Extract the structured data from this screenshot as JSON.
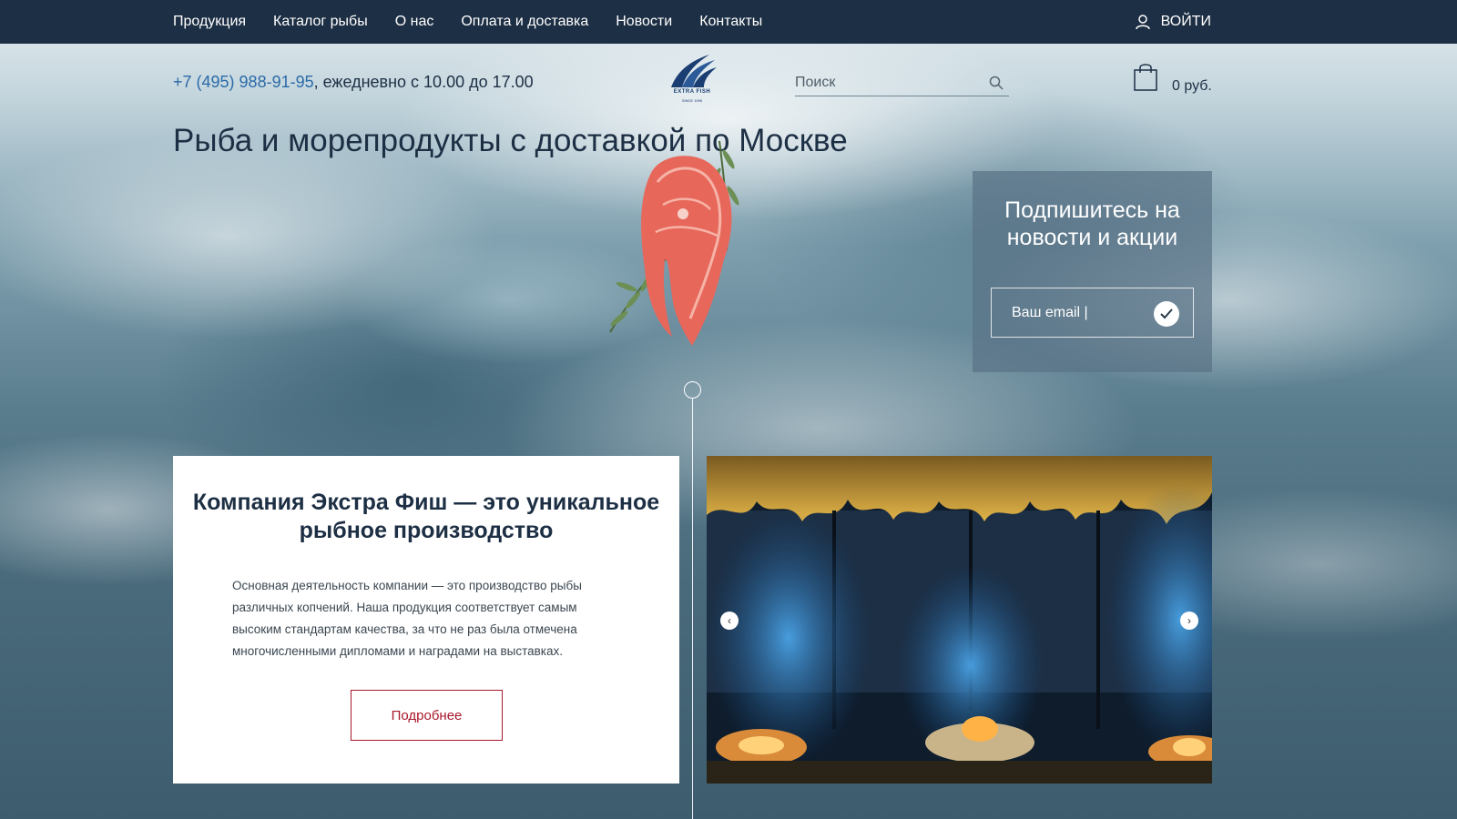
{
  "nav": {
    "items": [
      "Продукция",
      "Каталог рыбы",
      "О нас",
      "Оплата и доставка",
      "Новости",
      "Контакты"
    ],
    "login": "ВОЙТИ"
  },
  "header": {
    "phone": "+7 (495) 988-91-95",
    "hours": ", ежедневно с 10.00 до 17.00",
    "logo_text": "EXTRA FISH",
    "logo_since": "SINCE 1995",
    "search_placeholder": "Поиск",
    "cart_total": "0 руб."
  },
  "hero": {
    "title": "Рыба и морепродукты с доставкой по Москве"
  },
  "subscribe": {
    "title": "Подпишитесь на новости и акции",
    "placeholder": "Ваш email |"
  },
  "about": {
    "title": "Компания Экстра Фиш — это уникальное рыбное производство",
    "text": "Основная деятельность компании — это производство рыбы различных копчений. Наша продукция соответствует самым высоким стандартам качества, за что не раз была отмечена многочисленными дипломами и наградами на выставках.",
    "button": "Подробнее"
  },
  "colors": {
    "nav_bg": "#1d2f44",
    "text_dark": "#1d2f44",
    "phone_link": "#2b6aa8",
    "accent_red": "#a8182c"
  },
  "icons": {
    "user": "user-icon",
    "search": "search-icon",
    "cart": "shopping-bag-icon",
    "check": "check-icon",
    "slider_prev": "chevron-left-icon",
    "slider_next": "chevron-right-icon"
  }
}
